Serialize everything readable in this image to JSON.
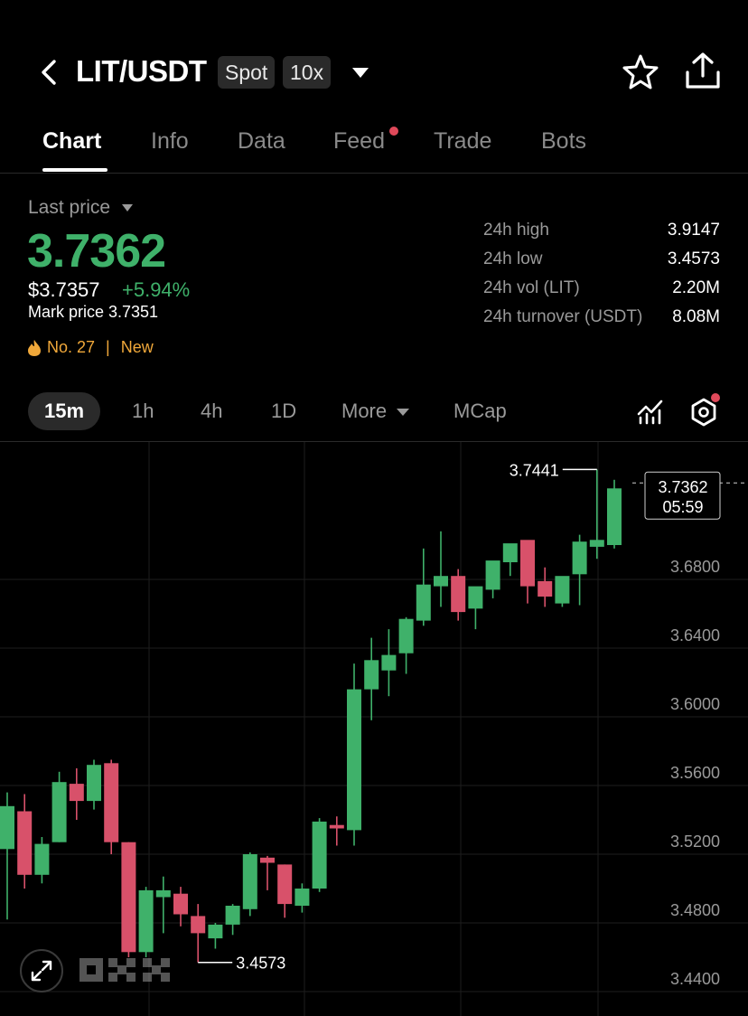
{
  "header": {
    "pair": "LIT/USDT",
    "market_tag": "Spot",
    "leverage_tag": "10x"
  },
  "tabs": [
    "Chart",
    "Info",
    "Data",
    "Feed",
    "Trade",
    "Bots"
  ],
  "active_tab": "Chart",
  "price": {
    "label": "Last price",
    "last": "3.7362",
    "usd": "$3.7357",
    "change": "+5.94%",
    "mark": "Mark price 3.7351",
    "rank": "No. 27",
    "badge": "New"
  },
  "stats": [
    {
      "label": "24h high",
      "value": "3.9147"
    },
    {
      "label": "24h low",
      "value": "3.4573"
    },
    {
      "label": "24h vol (LIT)",
      "value": "2.20M"
    },
    {
      "label": "24h turnover (USDT)",
      "value": "8.08M"
    }
  ],
  "timeframes": {
    "active": "15m",
    "items": [
      "1h",
      "4h",
      "1D",
      "More",
      "MCap"
    ]
  },
  "colors": {
    "up": "#3fb16a",
    "down": "#d8516a",
    "accent_orange": "#f0a83a",
    "notif_dot": "#e0495a"
  },
  "chart_data": {
    "type": "candlestick",
    "ylim": [
      3.44,
      3.76
    ],
    "yticks": [
      "3.6800",
      "3.6400",
      "3.6000",
      "3.5600",
      "3.5200",
      "3.4800",
      "3.4400"
    ],
    "current_price": "3.7362",
    "countdown": "05:59",
    "high_marker": "3.7441",
    "low_marker": "3.4573",
    "candles": [
      {
        "o": 3.523,
        "h": 3.556,
        "l": 3.482,
        "c": 3.548
      },
      {
        "o": 3.545,
        "h": 3.555,
        "l": 3.5,
        "c": 3.508
      },
      {
        "o": 3.508,
        "h": 3.53,
        "l": 3.503,
        "c": 3.526
      },
      {
        "o": 3.527,
        "h": 3.568,
        "l": 3.527,
        "c": 3.562
      },
      {
        "o": 3.561,
        "h": 3.57,
        "l": 3.54,
        "c": 3.551
      },
      {
        "o": 3.551,
        "h": 3.575,
        "l": 3.546,
        "c": 3.572
      },
      {
        "o": 3.573,
        "h": 3.575,
        "l": 3.52,
        "c": 3.527
      },
      {
        "o": 3.527,
        "h": 3.527,
        "l": 3.46,
        "c": 3.463
      },
      {
        "o": 3.463,
        "h": 3.501,
        "l": 3.46,
        "c": 3.499
      },
      {
        "o": 3.495,
        "h": 3.507,
        "l": 3.474,
        "c": 3.499
      },
      {
        "o": 3.497,
        "h": 3.501,
        "l": 3.478,
        "c": 3.485
      },
      {
        "o": 3.484,
        "h": 3.491,
        "l": 3.457,
        "c": 3.474
      },
      {
        "o": 3.471,
        "h": 3.48,
        "l": 3.465,
        "c": 3.479
      },
      {
        "o": 3.479,
        "h": 3.491,
        "l": 3.473,
        "c": 3.49
      },
      {
        "o": 3.488,
        "h": 3.521,
        "l": 3.484,
        "c": 3.52
      },
      {
        "o": 3.518,
        "h": 3.519,
        "l": 3.499,
        "c": 3.515
      },
      {
        "o": 3.514,
        "h": 3.514,
        "l": 3.483,
        "c": 3.491
      },
      {
        "o": 3.49,
        "h": 3.503,
        "l": 3.486,
        "c": 3.5
      },
      {
        "o": 3.5,
        "h": 3.541,
        "l": 3.498,
        "c": 3.539
      },
      {
        "o": 3.537,
        "h": 3.542,
        "l": 3.525,
        "c": 3.535
      },
      {
        "o": 3.534,
        "h": 3.631,
        "l": 3.525,
        "c": 3.616
      },
      {
        "o": 3.616,
        "h": 3.646,
        "l": 3.598,
        "c": 3.633
      },
      {
        "o": 3.627,
        "h": 3.651,
        "l": 3.612,
        "c": 3.636
      },
      {
        "o": 3.637,
        "h": 3.658,
        "l": 3.625,
        "c": 3.657
      },
      {
        "o": 3.656,
        "h": 3.698,
        "l": 3.653,
        "c": 3.677
      },
      {
        "o": 3.676,
        "h": 3.708,
        "l": 3.664,
        "c": 3.682
      },
      {
        "o": 3.682,
        "h": 3.686,
        "l": 3.656,
        "c": 3.661
      },
      {
        "o": 3.663,
        "h": 3.667,
        "l": 3.651,
        "c": 3.676
      },
      {
        "o": 3.674,
        "h": 3.69,
        "l": 3.669,
        "c": 3.691
      },
      {
        "o": 3.69,
        "h": 3.697,
        "l": 3.682,
        "c": 3.701
      },
      {
        "o": 3.703,
        "h": 3.7,
        "l": 3.666,
        "c": 3.676
      },
      {
        "o": 3.679,
        "h": 3.687,
        "l": 3.664,
        "c": 3.67
      },
      {
        "o": 3.666,
        "h": 3.68,
        "l": 3.664,
        "c": 3.682
      },
      {
        "o": 3.683,
        "h": 3.706,
        "l": 3.665,
        "c": 3.702
      },
      {
        "o": 3.699,
        "h": 3.744,
        "l": 3.692,
        "c": 3.703
      },
      {
        "o": 3.7,
        "h": 3.738,
        "l": 3.698,
        "c": 3.733
      }
    ]
  }
}
